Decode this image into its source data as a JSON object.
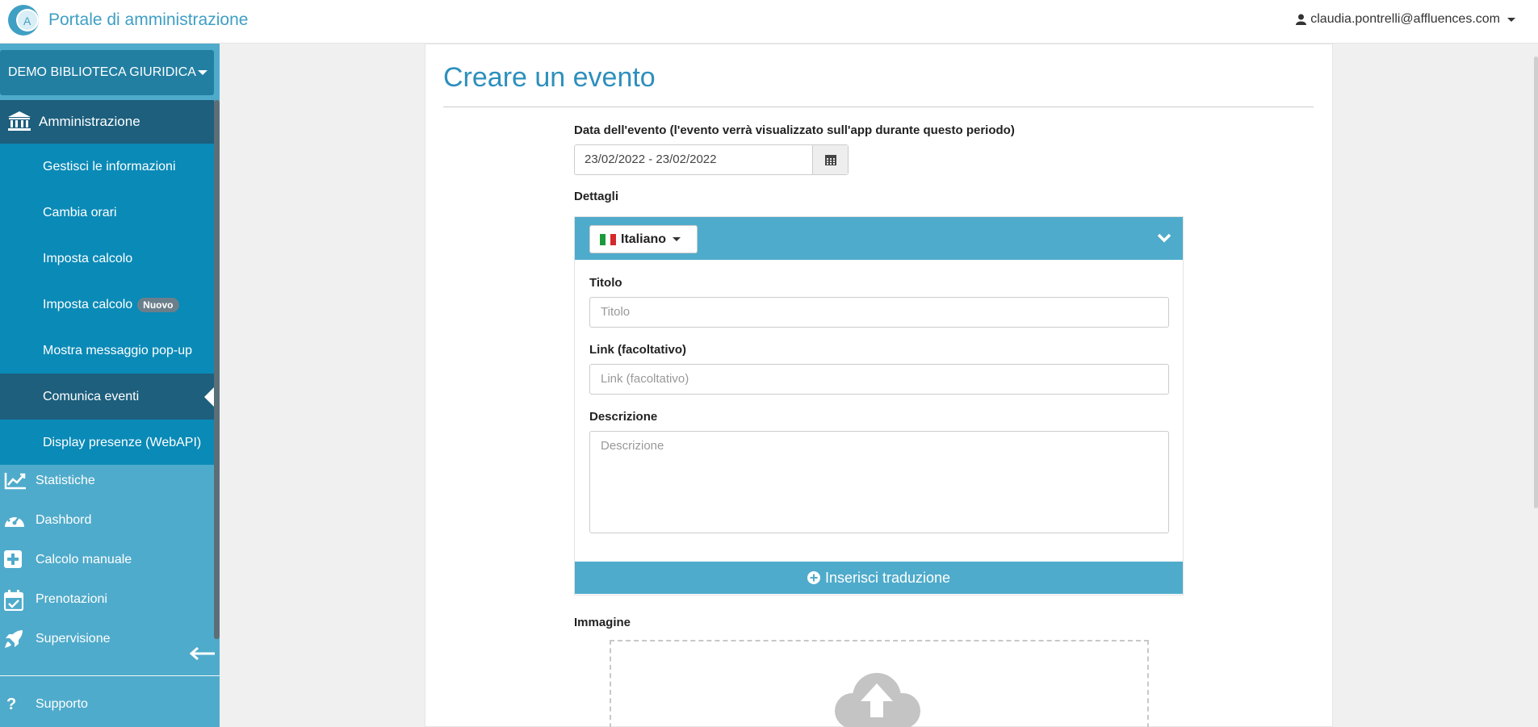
{
  "header": {
    "app_title": "Portale di amministrazione",
    "user_email": "claudia.pontrelli@affluences.com"
  },
  "sidebar": {
    "org_name": "DEMO BIBLIOTECA GIURIDICA",
    "section_title": "Amministrazione",
    "submenu": [
      {
        "label": "Gestisci le informazioni"
      },
      {
        "label": "Cambia orari"
      },
      {
        "label": "Imposta calcolo"
      },
      {
        "label": "Imposta calcolo",
        "badge": "Nuovo"
      },
      {
        "label": "Mostra messaggio pop-up"
      },
      {
        "label": "Comunica eventi",
        "active": true
      },
      {
        "label": "Display presenze (WebAPI)"
      }
    ],
    "nav": [
      {
        "label": "Statistiche",
        "icon": "chart-line-icon"
      },
      {
        "label": "Dashbord",
        "icon": "gauge-icon"
      },
      {
        "label": "Calcolo manuale",
        "icon": "plus-square-icon"
      },
      {
        "label": "Prenotazioni",
        "icon": "calendar-check-icon"
      },
      {
        "label": "Supervisione",
        "icon": "rocket-icon"
      }
    ],
    "support_label": "Supporto"
  },
  "main": {
    "page_title": "Creare un evento",
    "date_label": "Data dell'evento (l'evento verrà visualizzato sull'app durante questo periodo)",
    "date_value": "23/02/2022 - 23/02/2022",
    "details_label": "Dettagli",
    "language": "Italiano",
    "title_label": "Titolo",
    "title_placeholder": "Titolo",
    "link_label": "Link (facoltativo)",
    "link_placeholder": "Link (facoltativo)",
    "description_label": "Descrizione",
    "description_placeholder": "Descrizione",
    "add_translation_label": "Inserisci traduzione",
    "image_label": "Immagine"
  },
  "colors": {
    "accent": "#4fabcb",
    "sidebar_dark": "#1d5f7d",
    "submenu_bg": "#0a8ab7",
    "title_blue": "#2d8fbd"
  }
}
